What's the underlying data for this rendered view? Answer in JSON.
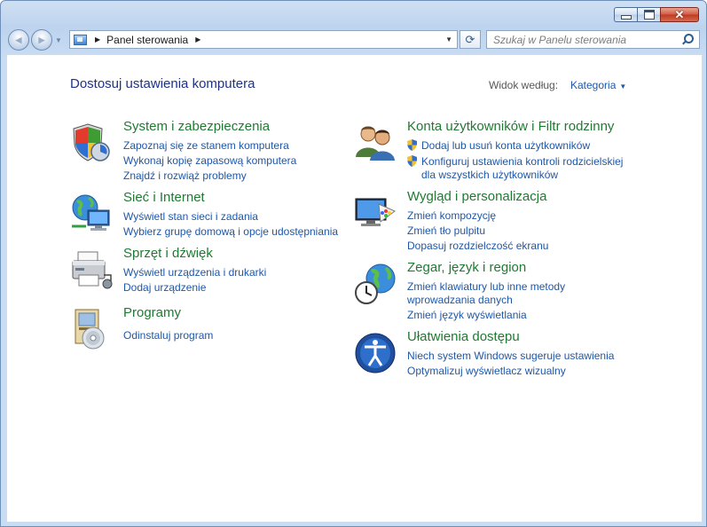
{
  "window": {
    "min_label": "▭",
    "max_label": "□",
    "close_label": "✕"
  },
  "nav": {
    "back_label": "◀",
    "forward_label": "▶",
    "history_label": "▼"
  },
  "address": {
    "crumb": "Panel sterowania",
    "separator": "▶",
    "dropdown": "▼",
    "refresh_label": "⟳"
  },
  "search": {
    "placeholder": "Szukaj w Panelu sterowania"
  },
  "content": {
    "title": "Dostosuj ustawienia komputera",
    "view_by_label": "Widok według:",
    "view_by_value": "Kategoria",
    "view_by_arrow": "▼"
  },
  "categories": {
    "left": [
      {
        "icon": "shield-security-icon",
        "title": "System i zabezpieczenia",
        "links": [
          "Zapoznaj się ze stanem komputera",
          "Wykonaj kopię zapasową komputera",
          "Znajdź i rozwiąż problemy"
        ]
      },
      {
        "icon": "network-globe-icon",
        "title": "Sieć i Internet",
        "links": [
          "Wyświetl stan sieci i zadania",
          "Wybierz grupę domową i opcje udostępniania"
        ]
      },
      {
        "icon": "printer-devices-icon",
        "title": "Sprzęt i dźwięk",
        "links": [
          "Wyświetl urządzenia i drukarki",
          "Dodaj urządzenie"
        ]
      },
      {
        "icon": "programs-disc-icon",
        "title": "Programy",
        "links": [
          "Odinstaluj program"
        ]
      }
    ],
    "right": [
      {
        "icon": "users-icon",
        "title": "Konta użytkowników i Filtr rodzinny",
        "links": [
          "Dodaj lub usuń konta użytkowników",
          "Konfiguruj ustawienia kontroli rodzicielskiej",
          "dla wszystkich użytkowników"
        ]
      },
      {
        "icon": "display-personalize-icon",
        "title": "Wygląd i personalizacja",
        "links": [
          "Zmień kompozycję",
          "Zmień tło pulpitu",
          "Dopasuj rozdzielczość ekranu"
        ]
      },
      {
        "icon": "clock-globe-icon",
        "title": "Zegar, język i region",
        "links": [
          "Zmień klawiatury lub inne metody",
          "wprowadzania danych",
          "Zmień język wyświetlania"
        ]
      },
      {
        "icon": "accessibility-icon",
        "title": "Ułatwienia dostępu",
        "links": [
          "Niech system Windows sugeruje ustawienia",
          "Optymalizuj wyświetlacz wizualny"
        ]
      }
    ]
  },
  "colors": {
    "link": "#1e57a8",
    "category_title": "#207a32",
    "page_title": "#1e3287"
  }
}
